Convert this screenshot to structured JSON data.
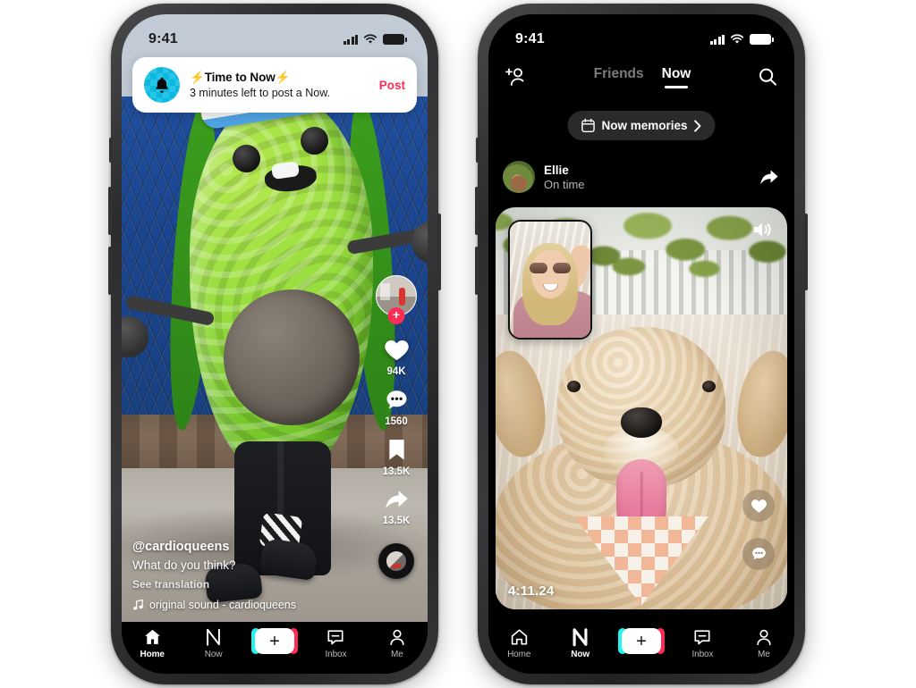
{
  "phone1": {
    "status": {
      "time": "9:41",
      "signal_icon": "cellular-bars-icon",
      "wifi_icon": "wifi-icon",
      "battery_icon": "battery-icon"
    },
    "notification": {
      "avatar_icon": "bell-icon",
      "title": "⚡Time to Now⚡",
      "subtitle": "3 minutes left to post a Now.",
      "action_label": "Post",
      "action_color": "#fe2c55"
    },
    "actions": {
      "follow_label": "+",
      "like_icon": "heart-icon",
      "like_count": "94K",
      "comment_icon": "comment-icon",
      "comment_count": "1560",
      "bookmark_icon": "bookmark-icon",
      "bookmark_count": "13.5K",
      "share_icon": "share-arrow-icon",
      "share_count": "13.5K",
      "disc_icon": "music-disc-icon"
    },
    "caption": {
      "username": "@cardioqueens",
      "text": "What do you think?",
      "translate_label": "See translation",
      "music_icon": "music-note-icon",
      "music": "original sound - cardioqueens"
    },
    "tabbar": {
      "items": [
        {
          "label": "Home",
          "icon": "home-icon",
          "active": true
        },
        {
          "label": "Now",
          "icon": "now-bolt-icon",
          "active": false
        },
        {
          "label": "",
          "icon": "plus-icon",
          "active": false
        },
        {
          "label": "Inbox",
          "icon": "inbox-icon",
          "active": false
        },
        {
          "label": "Me",
          "icon": "person-icon",
          "active": false
        }
      ],
      "plus_label": "+",
      "plus_accent_left": "#25f4ee",
      "plus_accent_right": "#fe2c55"
    }
  },
  "phone2": {
    "status": {
      "time": "9:41",
      "signal_icon": "cellular-bars-icon",
      "wifi_icon": "wifi-icon",
      "battery_icon": "battery-icon"
    },
    "header": {
      "add_friend_icon": "add-person-icon",
      "tabs": [
        {
          "label": "Friends",
          "active": false
        },
        {
          "label": "Now",
          "active": true
        }
      ],
      "search_icon": "search-icon"
    },
    "memories": {
      "icon": "calendar-icon",
      "label": "Now memories",
      "chevron_icon": "chevron-right-icon"
    },
    "post": {
      "avatar_icon": "user-avatar",
      "name": "Ellie",
      "status": "On time",
      "share_icon": "share-arrow-icon",
      "timestamp": "4:11.24",
      "speaker_icon": "speaker-on-icon",
      "like_icon": "heart-icon",
      "comment_icon": "comment-icon"
    },
    "tabbar": {
      "items": [
        {
          "label": "Home",
          "icon": "home-icon",
          "active": false
        },
        {
          "label": "Now",
          "icon": "now-bolt-icon",
          "active": true
        },
        {
          "label": "",
          "icon": "plus-icon",
          "active": false
        },
        {
          "label": "Inbox",
          "icon": "inbox-icon",
          "active": false
        },
        {
          "label": "Me",
          "icon": "person-icon",
          "active": false
        }
      ],
      "plus_label": "+",
      "plus_accent_left": "#25f4ee",
      "plus_accent_right": "#fe2c55"
    }
  }
}
